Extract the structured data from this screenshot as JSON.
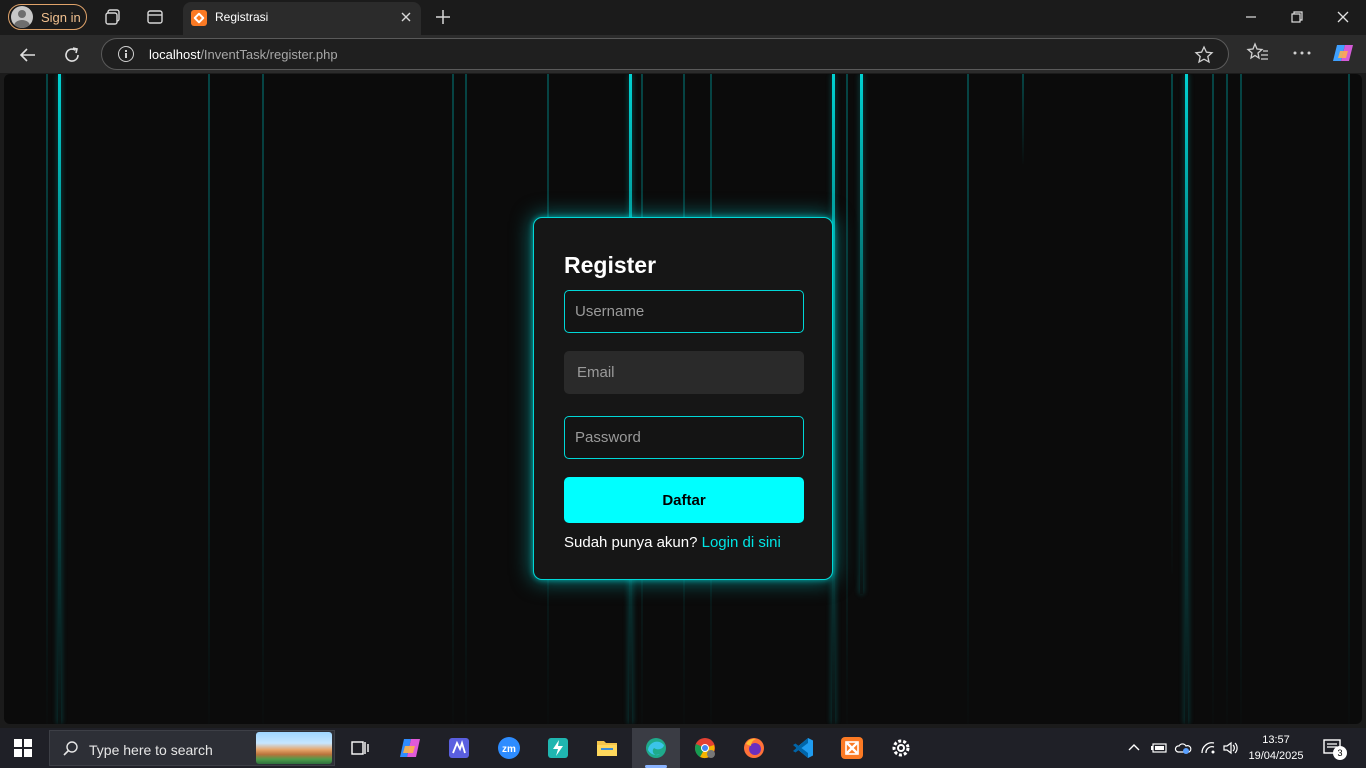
{
  "browser": {
    "signin_label": "Sign in",
    "tab_title": "Registrasi",
    "url_host": "localhost",
    "url_path": "/InventTask/register.php"
  },
  "page": {
    "title": "Register",
    "username_placeholder": "Username",
    "email_placeholder": "Email",
    "password_placeholder": "Password",
    "submit_label": "Daftar",
    "footnote_text": "Sudah punya akun?",
    "login_link": "Login di sini"
  },
  "colors": {
    "accent": "#00ffff",
    "background": "#0b0b0b",
    "card": "#161616"
  },
  "taskbar": {
    "search_placeholder": "Type here to search",
    "time": "13:57",
    "date": "19/04/2025",
    "notification_count": "3",
    "apps": [
      "copilot-icon",
      "linear-icon",
      "zoom-icon",
      "bolt-icon",
      "file-explorer-icon",
      "edge-icon",
      "chrome-icon",
      "firefox-icon",
      "vscode-icon",
      "xampp-icon",
      "settings-icon"
    ]
  }
}
